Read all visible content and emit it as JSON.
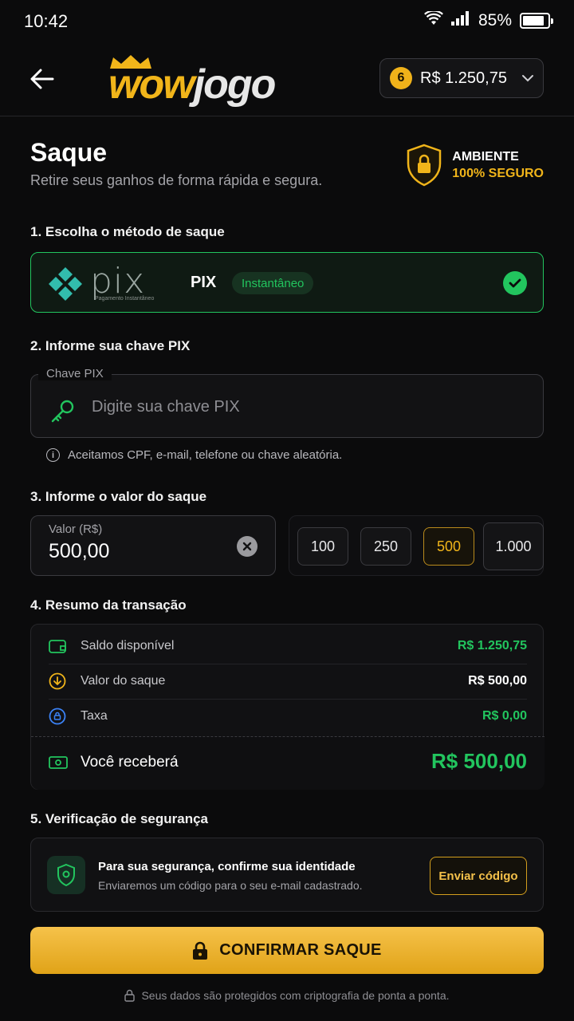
{
  "status_bar": {
    "time": "10:42",
    "battery": "85%",
    "battery_level": 0.85
  },
  "header": {
    "logo": {
      "wow": "wow",
      "jogo": "jogo"
    },
    "balance": "R$ 1.250,75",
    "coin_symbol": "6"
  },
  "page": {
    "title": "Saque",
    "subtitle": "Retire seus ganhos de forma rápida e segura.",
    "secure_line1": "AMBIENTE",
    "secure_line2": "100% SEGURO"
  },
  "step1": {
    "label": "1. Escolha o método de saque",
    "pix_word": "pix",
    "pix_sub": "Pagamento Instantâneo",
    "method_name": "PIX",
    "method_tag": "Instantâneo"
  },
  "step2": {
    "label": "2. Informe sua chave PIX",
    "legend": "Chave PIX",
    "placeholder": "Digite sua chave PIX",
    "hint": "Aceitamos CPF, e-mail, telefone ou chave aleatória."
  },
  "step3": {
    "label": "3. Informe o valor do saque",
    "amount_label": "Valor (R$)",
    "amount_value": "500,00",
    "chips": [
      "100",
      "250",
      "500",
      "1.000"
    ],
    "active_chip": "500"
  },
  "step4": {
    "label": "4. Resumo da transação",
    "rows": [
      {
        "label": "Saldo disponível",
        "value": "R$ 1.250,75",
        "color": "#22c55e"
      },
      {
        "label": "Valor do saque",
        "value": "R$ 500,00",
        "color": "#ffffff"
      },
      {
        "label": "Taxa",
        "value": "R$ 0,00",
        "color": "#22c55e"
      }
    ],
    "total_label": "Você receberá",
    "total_value": "R$ 500,00"
  },
  "step5": {
    "label": "5. Verificação de segurança",
    "title": "Para sua segurança, confirme sua identidade",
    "subtitle": "Enviaremos um código para o seu e-mail cadastrado.",
    "button": "Enviar código"
  },
  "confirm": {
    "label": "CONFIRMAR SAQUE"
  },
  "footer": {
    "note": "Seus dados são protegidos com criptografia de ponta a ponta."
  },
  "colors": {
    "accent": "#f1b51a",
    "success": "#22c55e",
    "background": "#0b0b0c"
  }
}
